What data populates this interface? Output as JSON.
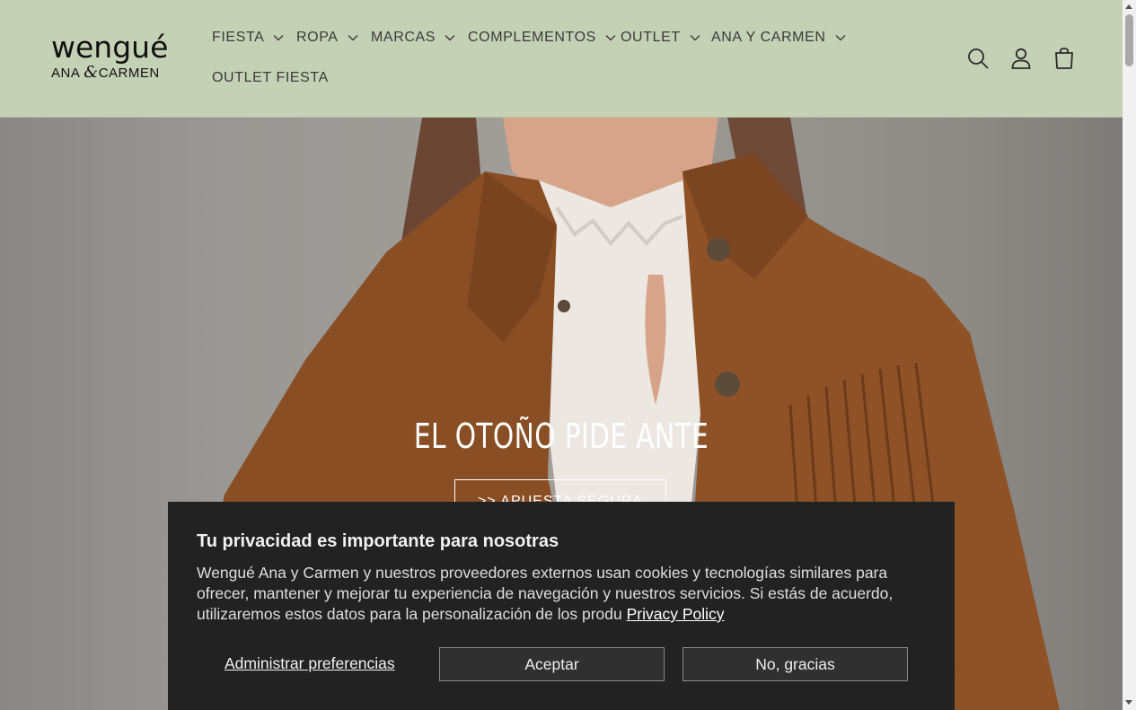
{
  "brand": {
    "name": "wengué",
    "sub_left": "ANA",
    "sub_amp": "&",
    "sub_right": "CARMEN"
  },
  "nav": [
    {
      "label": "FIESTA",
      "has_dropdown": true
    },
    {
      "label": "ROPA",
      "has_dropdown": true
    },
    {
      "label": "MARCAS",
      "has_dropdown": true
    },
    {
      "label": "COMPLEMENTOS",
      "has_dropdown": true
    },
    {
      "label": "OUTLET",
      "has_dropdown": true
    },
    {
      "label": "ANA Y CARMEN",
      "has_dropdown": true
    },
    {
      "label": "OUTLET FIESTA",
      "has_dropdown": false
    }
  ],
  "header_icons": [
    "search-icon",
    "account-icon",
    "cart-icon"
  ],
  "hero": {
    "title": "EL OTOÑO PIDE ANTE",
    "button_label": ">> APUESTA SEGURA"
  },
  "cookie": {
    "title": "Tu privacidad es importante para nosotras",
    "text": "Wengué Ana y Carmen y nuestros proveedores externos usan cookies y tecnologías similares para ofrecer, mantener y mejorar tu experiencia de navegación y nuestros servicios. Si estás de acuerdo, utilizaremos estos datos para la personalización de los produ",
    "link_label": "Privacy Policy",
    "manage_label": "Administrar preferencias",
    "accept_label": "Aceptar",
    "decline_label": "No, gracias"
  },
  "colors": {
    "header_bg": "#c4d1b5",
    "banner_bg": "#222222",
    "jacket": "#8a4e24"
  }
}
